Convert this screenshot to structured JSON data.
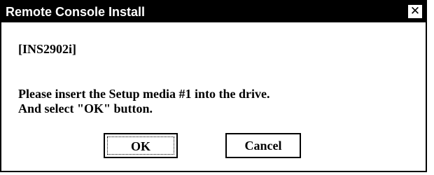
{
  "window": {
    "title": "Remote Console Install",
    "close_glyph": "✕"
  },
  "message": {
    "code": "[INS2902i]",
    "line1": "Please insert the Setup media #1 into the drive.",
    "line2": "And select \"OK\" button."
  },
  "buttons": {
    "ok": "OK",
    "cancel": "Cancel"
  }
}
